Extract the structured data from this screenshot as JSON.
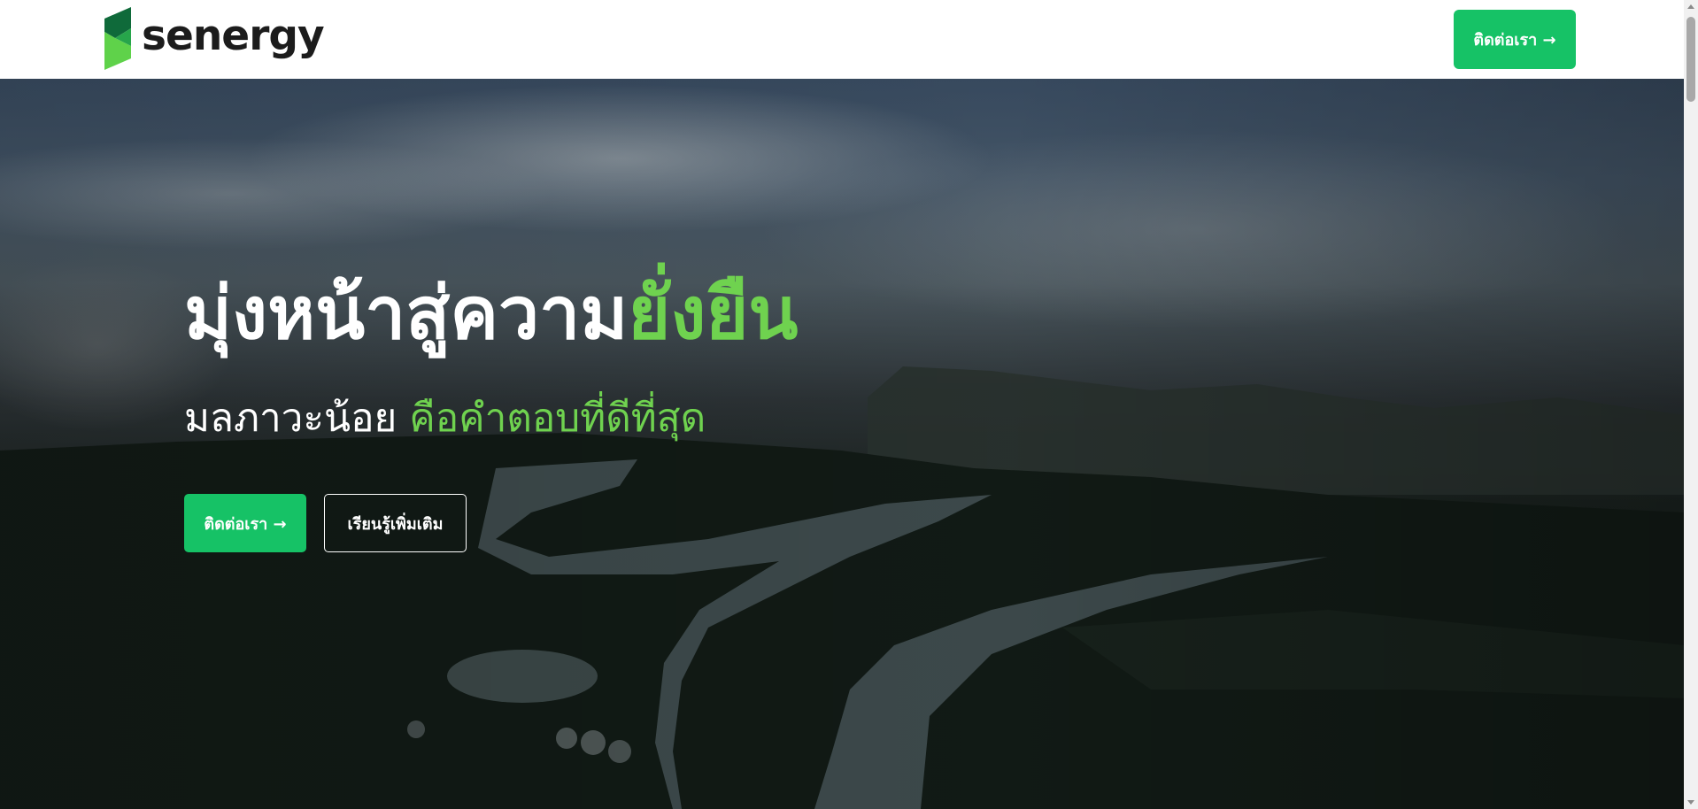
{
  "header": {
    "brand": "senergy",
    "contact_label": "ติดต่อเรา →"
  },
  "hero": {
    "title_main": "มุ่งหน้าสู่ความ",
    "title_accent": "ยั่งยืน",
    "subtitle_main": "มลภาวะน้อย ",
    "subtitle_accent": "คือคำตอบที่ดีที่สุด",
    "primary_label": "ติดต่อเรา →",
    "secondary_label": "เรียนรู้เพิ่มเติม"
  },
  "colors": {
    "brand_green": "#16c266",
    "accent_green": "#6fd24f",
    "logo_dark_green": "#0f6a3a",
    "logo_light_green": "#5fd24a"
  },
  "icons": {
    "logo": "senergy-logo-icon",
    "arrow": "arrow-right-icon"
  }
}
